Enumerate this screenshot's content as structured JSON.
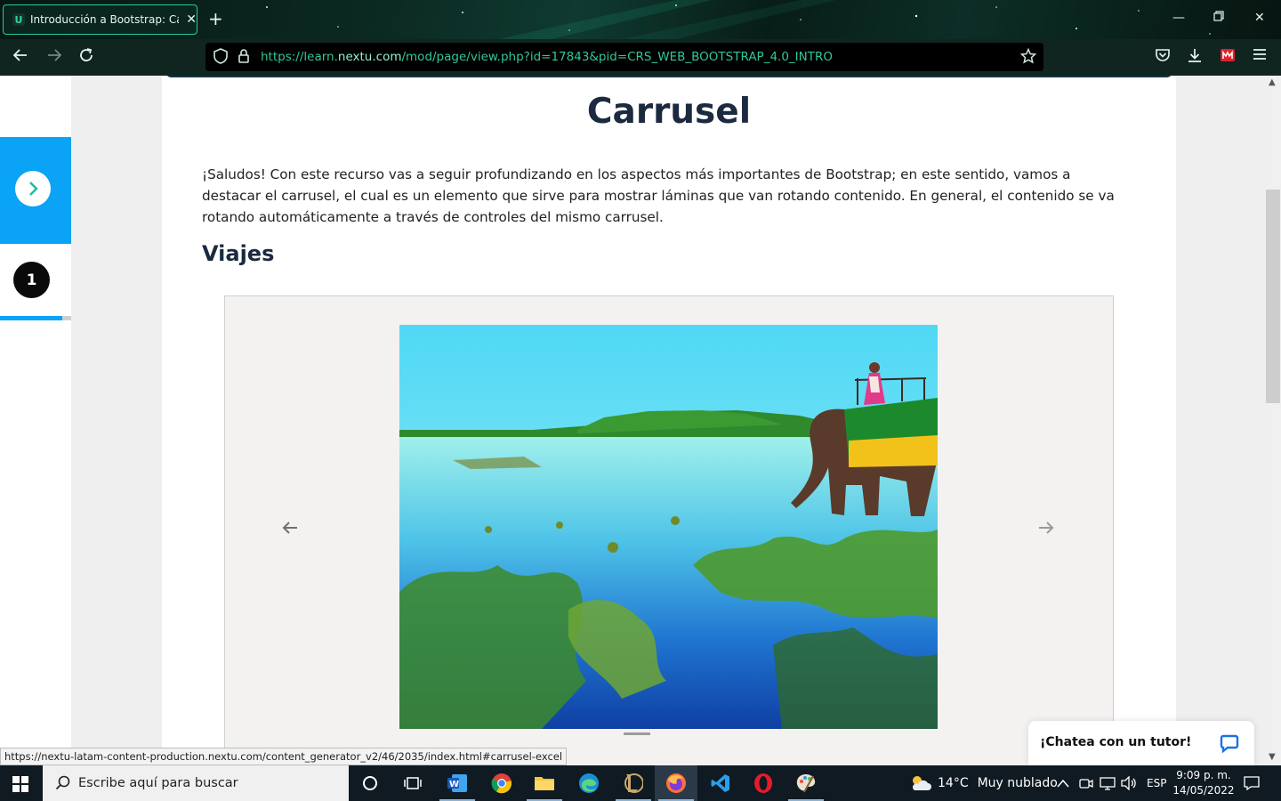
{
  "browser": {
    "tab_title": "Introducción a Bootstrap: Carrusel",
    "url_prefix": "https://learn.",
    "url_domain": "nextu.com",
    "url_suffix": "/mod/page/view.php?id=17843&pid=CRS_WEB_BOOTSTRAP_4.0_INTRO",
    "status_url": "https://nextu-latam-content-production.nextu.com/content_generator_v2/46/2035/index.html#carrusel-excel"
  },
  "sidebar": {
    "step_number": "1"
  },
  "page": {
    "title": "Carrusel",
    "intro": "¡Saludos! Con este recurso vas a seguir profundizando en los aspectos más importantes de Bootstrap; en este sentido, vamos a destacar el carrusel, el cual es un elemento que sirve para mostrar láminas que van rotando contenido. En general, el contenido se va rotando automáticamente a través de controles del mismo carrusel.",
    "section_title": "Viajes"
  },
  "carousel": {
    "prev_arrow": "←",
    "next_arrow": "→"
  },
  "chat": {
    "label": "¡Chatea con un tutor!"
  },
  "taskbar": {
    "search_placeholder": "Escribe aquí para buscar",
    "weather_temp": "14°C",
    "weather_desc": "Muy nublado",
    "language": "ESP",
    "time": "9:09 p. m.",
    "date": "14/05/2022"
  },
  "colors": {
    "accent_blue": "#0aa3f5",
    "heading": "#1b2a3f",
    "url_green": "#2fc79c"
  }
}
